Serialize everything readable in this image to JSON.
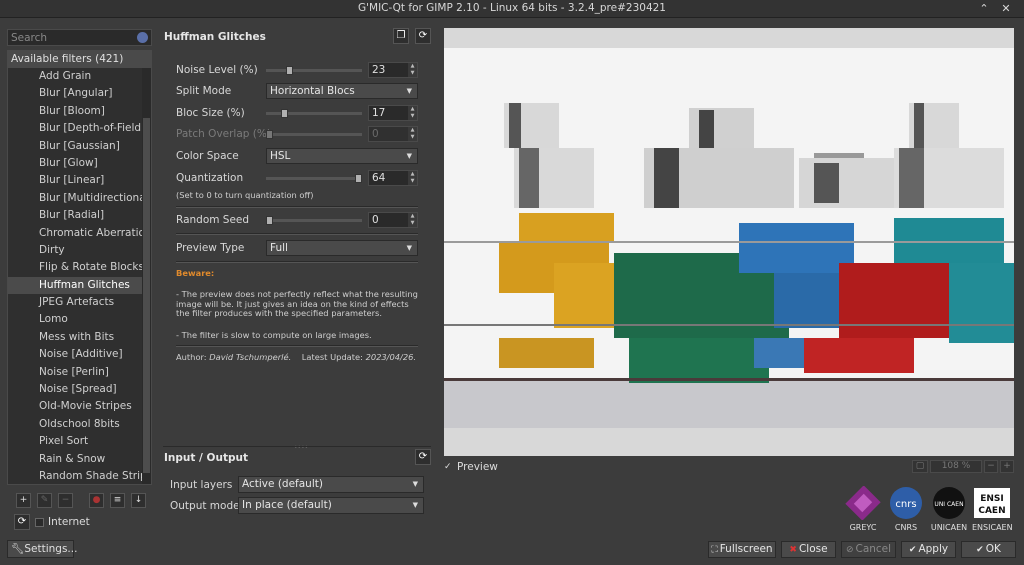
{
  "window": {
    "title": "G'MIC-Qt for GIMP 2.10 - Linux 64 bits - 3.2.4_pre#230421",
    "controls": [
      "⌃",
      "✕"
    ]
  },
  "search": {
    "placeholder": "Search"
  },
  "filter_list": {
    "header": "Available filters (421)",
    "items": [
      "Add Grain",
      "Blur [Angular]",
      "Blur [Bloom]",
      "Blur [Depth-of-Field]",
      "Blur [Gaussian]",
      "Blur [Glow]",
      "Blur [Linear]",
      "Blur [Multidirectional]",
      "Blur [Radial]",
      "Chromatic Aberration",
      "Dirty",
      "Flip & Rotate Blocks",
      "Huffman Glitches",
      "JPEG Artefacts",
      "Lomo",
      "Mess with Bits",
      "Noise [Additive]",
      "Noise [Perlin]",
      "Noise [Spread]",
      "Old-Movie Stripes",
      "Oldschool 8bits",
      "Pixel Sort",
      "Rain & Snow",
      "Random Shade Stripes"
    ],
    "selected": "Huffman Glitches"
  },
  "left_footer": {
    "internet_label": "Internet",
    "settings_label": "Settings..."
  },
  "filter": {
    "title": "Huffman Glitches",
    "params": {
      "noise_level": {
        "label": "Noise Level (%)",
        "value": "23",
        "fraction": 0.23
      },
      "split_mode": {
        "label": "Split Mode",
        "value": "Horizontal Blocs"
      },
      "bloc_size": {
        "label": "Bloc Size (%)",
        "value": "17",
        "fraction": 0.17
      },
      "patch_overlap": {
        "label": "Patch Overlap (%)",
        "value": "0",
        "fraction": 0.0
      },
      "color_space": {
        "label": "Color Space",
        "value": "HSL"
      },
      "quantization": {
        "label": "Quantization",
        "value": "64",
        "fraction": 1.0
      },
      "quantization_note": "(Set to 0 to turn quantization off)",
      "random_seed": {
        "label": "Random Seed",
        "value": "0",
        "fraction": 0.0
      },
      "preview_type": {
        "label": "Preview Type",
        "value": "Full"
      }
    },
    "beware": "Beware:",
    "note1": "- The preview does not perfectly reflect what the resulting image will be. It just gives an idea on the kind of effects the filter produces with the specified parameters.",
    "note2": "- The filter is slow to compute on large images.",
    "author_label": "Author:",
    "author_name": "David Tschumperlé.",
    "update_label": "Latest Update:",
    "update_date": "2023/04/26."
  },
  "io": {
    "title": "Input / Output",
    "input_layers_label": "Input layers",
    "input_layers_value": "Active (default)",
    "output_mode_label": "Output mode",
    "output_mode_value": "In place (default)"
  },
  "preview": {
    "checkbox_label": "Preview",
    "zoom": "108 %"
  },
  "logos": [
    {
      "label": "GREYC",
      "color": "#8a2a8a"
    },
    {
      "label": "CNRS",
      "color": "#2e5ea8"
    },
    {
      "label": "UNICAEN",
      "color": "#111111"
    },
    {
      "label": "ENSICAEN",
      "color": "#ffffff"
    }
  ],
  "logo_texts": {
    "cnrs": "cnrs",
    "unicaen": "UNI CAEN",
    "ensicaen": "ENSI CAEN"
  },
  "buttons": {
    "fullscreen": "Fullscreen",
    "close": "Close",
    "cancel": "Cancel",
    "apply": "Apply",
    "ok": "OK"
  }
}
